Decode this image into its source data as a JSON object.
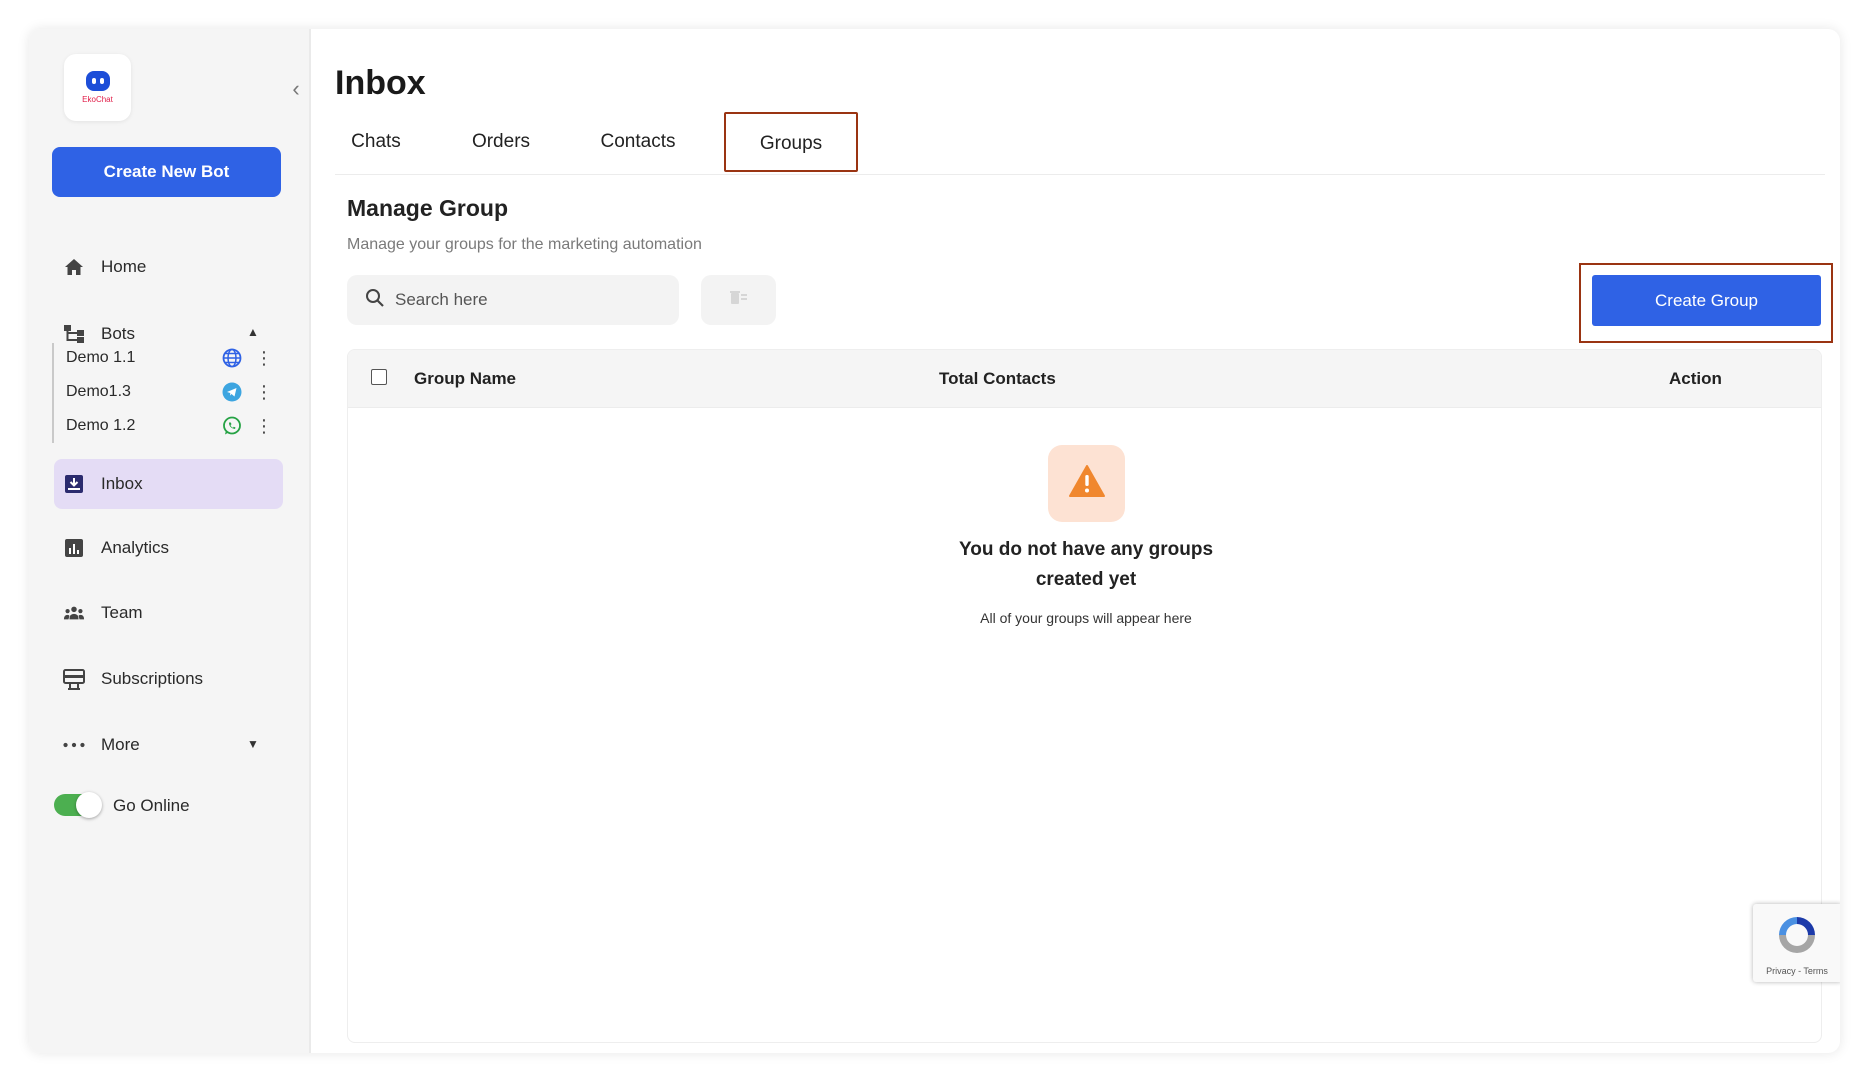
{
  "app": {
    "logo_text": "EkoChat"
  },
  "sidebar": {
    "create_bot_label": "Create New Bot",
    "nav": {
      "home": "Home",
      "bots": "Bots",
      "inbox": "Inbox",
      "analytics": "Analytics",
      "team": "Team",
      "subscriptions": "Subscriptions",
      "more": "More"
    },
    "bots": [
      {
        "name": "Demo 1.1",
        "channel": "web-globe-icon"
      },
      {
        "name": "Demo1.3",
        "channel": "telegram-icon"
      },
      {
        "name": "Demo 1.2",
        "channel": "whatsapp-icon"
      }
    ],
    "go_online_label": "Go Online",
    "go_online_on": true
  },
  "page": {
    "title": "Inbox",
    "tabs": [
      "Chats",
      "Orders",
      "Contacts",
      "Groups"
    ],
    "active_tab": "Groups"
  },
  "manage": {
    "title": "Manage Group",
    "subtitle": "Manage your groups for the marketing automation",
    "search_placeholder": "Search here",
    "create_group_label": "Create Group"
  },
  "table": {
    "columns": [
      "Group Name",
      "Total Contacts",
      "Action"
    ],
    "rows": [],
    "empty_title": "You do not have any groups created yet",
    "empty_subtitle": "All of your groups will appear here"
  },
  "recaptcha": {
    "terms": "Privacy - Terms"
  },
  "colors": {
    "primary": "#2f62e5",
    "highlight_outline": "#9a3412",
    "active_nav": "#e4dcf5",
    "toggle_on": "#4caf50",
    "warning": "#f0872e"
  }
}
